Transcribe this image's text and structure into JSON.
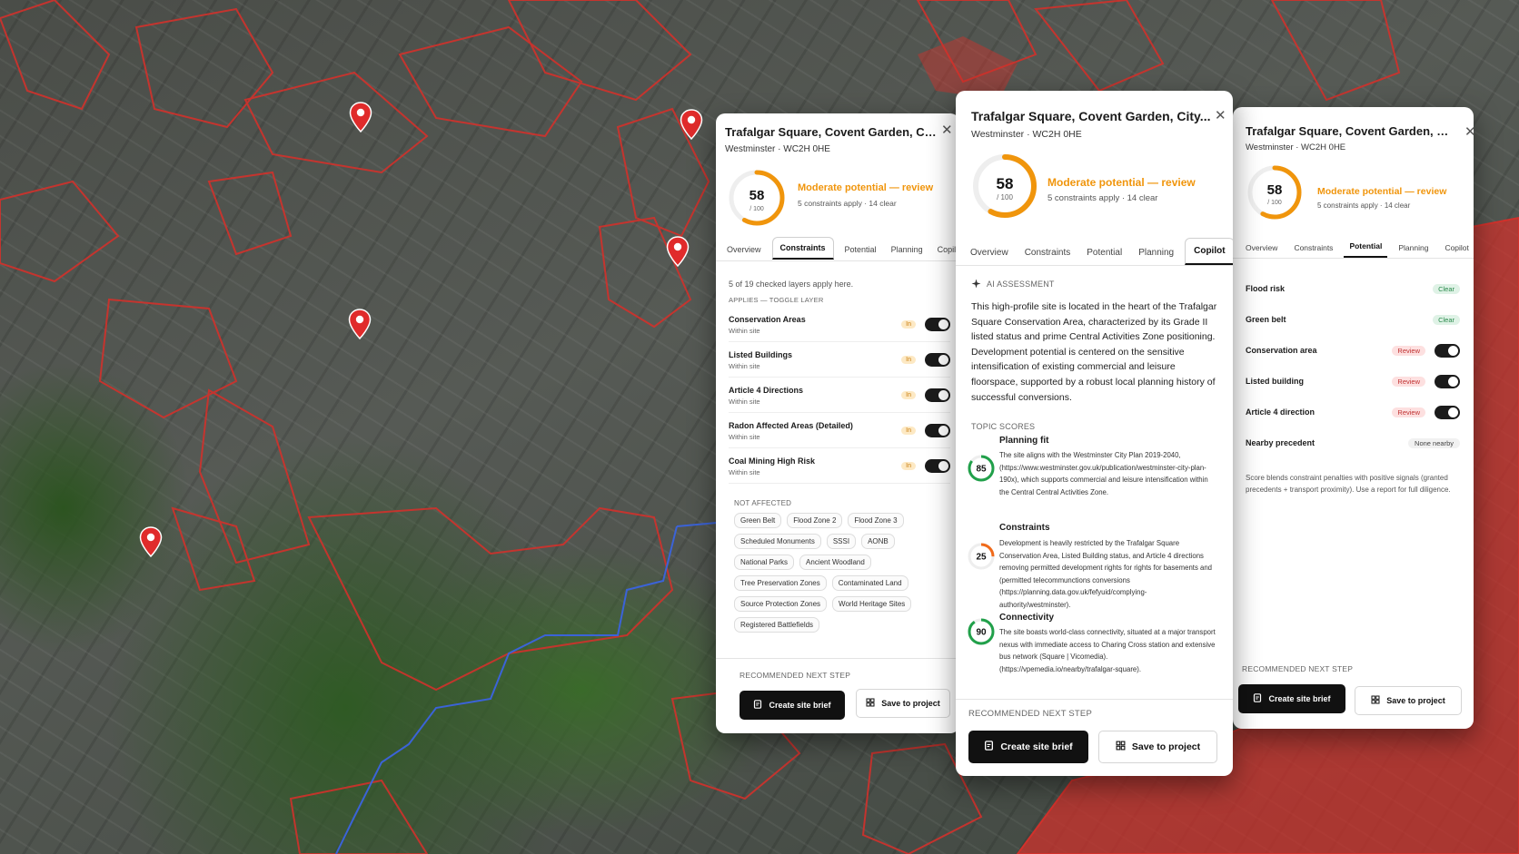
{
  "colors": {
    "accent_orange": "#f0950c",
    "review_red": "#c03333",
    "clear_green": "#2a8a4c",
    "score_green": "#21a04a",
    "score_orange": "#f06a1a",
    "parcel_red": "#d2312b",
    "route_blue": "#3b63d8"
  },
  "map": {
    "marker_icon": "map-pin-icon"
  },
  "site": {
    "title": "Trafalgar Square, Covent Garden, City...",
    "subtitle": "Westminster · WC2H 0HE",
    "score": "58",
    "score_den": "/ 100",
    "score_fraction": 0.58,
    "verdict": "Moderate potential — review",
    "verdict_sub": "5 constraints apply · 14 clear"
  },
  "tabs": [
    "Overview",
    "Constraints",
    "Potential",
    "Planning",
    "Copilot"
  ],
  "constraints_panel": {
    "summary": "5 of 19 checked layers apply here.",
    "applies_label": "APPLIES — TOGGLE LAYER",
    "applies": [
      {
        "name": "Conservation Areas",
        "note": "Within site",
        "badge": "In"
      },
      {
        "name": "Listed Buildings",
        "note": "Within site",
        "badge": "In"
      },
      {
        "name": "Article 4 Directions",
        "note": "Within site",
        "badge": "In"
      },
      {
        "name": "Radon Affected Areas (Detailed)",
        "note": "Within site",
        "badge": "In"
      },
      {
        "name": "Coal Mining High Risk",
        "note": "Within site",
        "badge": "In"
      }
    ],
    "not_affected_label": "NOT AFFECTED",
    "not_affected": [
      "Green Belt",
      "Flood Zone 2",
      "Flood Zone 3",
      "Scheduled Monuments",
      "SSSI",
      "AONB",
      "National Parks",
      "Ancient Woodland",
      "Tree Preservation Zones",
      "Contaminated Land",
      "Source Protection Zones",
      "World Heritage Sites",
      "Registered Battlefields"
    ]
  },
  "copilot_panel": {
    "assessment_label": "AI ASSESSMENT",
    "assessment": "This high-profile site is located in the heart of the Trafalgar Square Conservation Area, characterized by its Grade II listed status and prime Central Activities Zone positioning. Development potential is centered on the sensitive intensification of existing commercial and leisure floorspace, supported by a robust local planning history of successful conversions.",
    "topic_scores_label": "TOPIC SCORES",
    "topics": [
      {
        "title": "Planning fit",
        "score": "85",
        "fraction": 0.85,
        "tone": "green",
        "text": "The site aligns with the Westminster City Plan 2019-2040, (https://www.westminster.gov.uk/publication/westminster-city-plan-190x), which supports commercial and leisure intensification within the Central Central Activities Zone."
      },
      {
        "title": "Constraints",
        "score": "25",
        "fraction": 0.25,
        "tone": "orange",
        "text": "Development is heavily restricted by the Trafalgar Square Conservation Area, Listed Building status, and Article 4 directions removing permitted development rights for rights for basements and (permitted telecommunctions conversions (https://planning.data.gov.uk/fefyuid/complying-authority/westminster)."
      },
      {
        "title": "Connectivity",
        "score": "90",
        "fraction": 0.9,
        "tone": "green",
        "text": "The site boasts world-class connectivity, situated at a major transport nexus with immediate access to Charing Cross station and extensive bus network (Square | Vicomedia). (https://vpemedia.io/nearby/trafalgar-square)."
      }
    ]
  },
  "potential_panel": {
    "items": [
      {
        "name": "Flood risk",
        "status": "Clear",
        "kind": "clear",
        "toggle": false
      },
      {
        "name": "Green belt",
        "status": "Clear",
        "kind": "clear",
        "toggle": false
      },
      {
        "name": "Conservation area",
        "status": "Review",
        "kind": "review",
        "toggle": true
      },
      {
        "name": "Listed building",
        "status": "Review",
        "kind": "review",
        "toggle": true
      },
      {
        "name": "Article 4 direction",
        "status": "Review",
        "kind": "review",
        "toggle": true
      },
      {
        "name": "Nearby precedent",
        "status": "None nearby",
        "kind": "none",
        "toggle": false
      }
    ],
    "note": "Score blends constraint penalties with positive signals (granted precedents + transport proximity). Use a report for full diligence."
  },
  "next_step": {
    "label": "RECOMMENDED NEXT STEP",
    "primary": "Create site brief",
    "secondary": "Save to project"
  }
}
